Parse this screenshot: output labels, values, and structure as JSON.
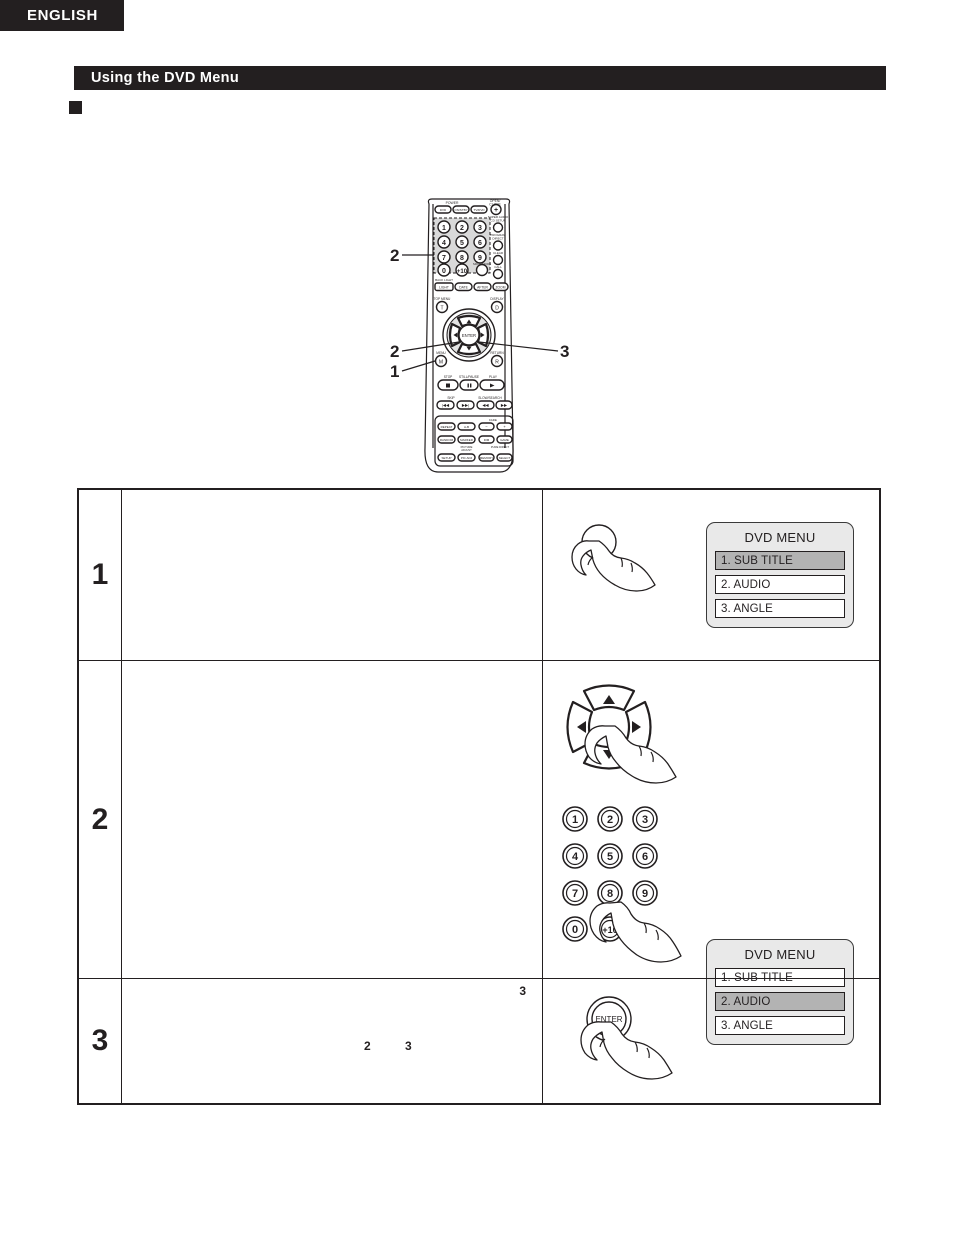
{
  "page": {
    "language_tab": "ENGLISH",
    "section_title": "Using the DVD Menu",
    "bullet_icon": "black-square-bullet"
  },
  "remote_figure": {
    "name": "remote-control-diagram",
    "callouts": [
      {
        "label": "2",
        "target": "number-buttons"
      },
      {
        "label": "2",
        "target": "cursor-buttons"
      },
      {
        "label": "1",
        "target": "menu-button"
      },
      {
        "label": "3",
        "target": "enter-button"
      }
    ],
    "button_labels": {
      "menu": "MENU",
      "enter": "ENTER",
      "top_menu": "TOP MENU",
      "display": "DISPLAY",
      "return": "RETURN",
      "open_close": "OPEN/CLOSE",
      "stop": "STOP",
      "still_pause": "STILL/PAUSE",
      "play": "PLAY",
      "skip": "SKIP",
      "slow_search": "SLOW/SEARCH"
    }
  },
  "steps": [
    {
      "number": "1",
      "description": "",
      "illustration": {
        "type": "press-round-button-hand",
        "button_label": ""
      },
      "screen": {
        "title": "DVD MENU",
        "items": [
          {
            "label": "1. SUB TITLE",
            "selected": true
          },
          {
            "label": "2. AUDIO",
            "selected": false
          },
          {
            "label": "3. ANGLE",
            "selected": false
          }
        ]
      }
    },
    {
      "number": "2",
      "description": "",
      "inline_refs": [
        {
          "label": "3"
        }
      ],
      "illustration": {
        "type": "cursor-pad-and-keypad",
        "cursor_arrows": [
          "up",
          "down",
          "left",
          "right"
        ],
        "keypad": [
          "1",
          "2",
          "3",
          "4",
          "5",
          "6",
          "7",
          "8",
          "9",
          "0",
          "+10"
        ]
      },
      "screen": {
        "title": "DVD MENU",
        "items": [
          {
            "label": "1. SUB TITLE",
            "selected": false
          },
          {
            "label": "2. AUDIO",
            "selected": true
          },
          {
            "label": "3. ANGLE",
            "selected": false
          }
        ]
      }
    },
    {
      "number": "3",
      "description": "",
      "inline_refs": [
        {
          "label": "2"
        },
        {
          "label": "3"
        }
      ],
      "illustration": {
        "type": "press-enter-button-hand",
        "button_label": "ENTER"
      },
      "screen": null
    }
  ],
  "colors": {
    "ink": "#231f20",
    "paper": "#ffffff",
    "screen_bg": "#e9e9e9",
    "highlight": "#b3b3b3"
  }
}
